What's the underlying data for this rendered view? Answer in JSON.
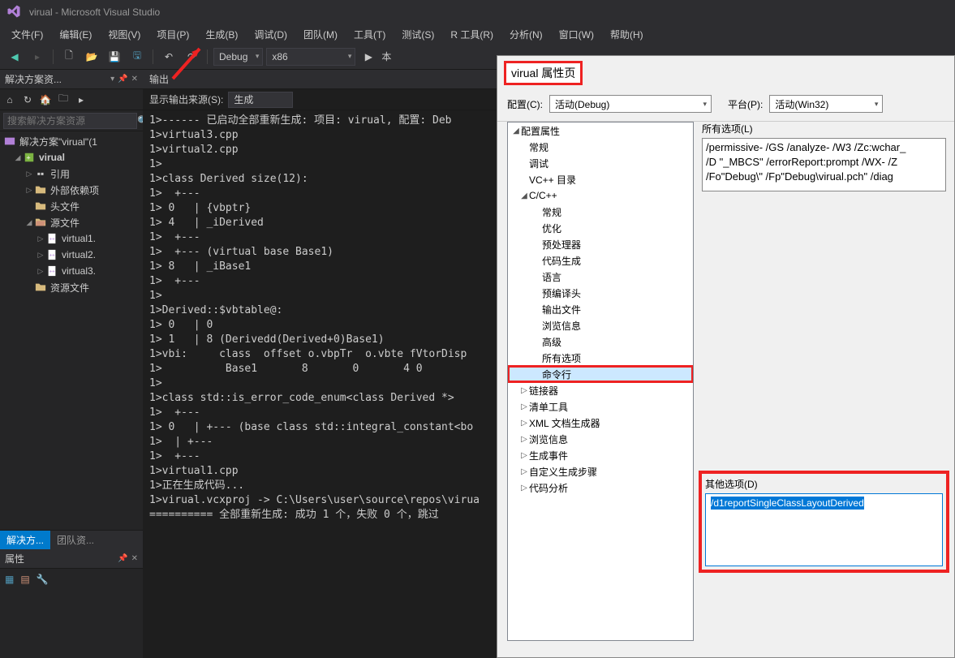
{
  "title": "virual - Microsoft Visual Studio",
  "menu": [
    "文件(F)",
    "编辑(E)",
    "视图(V)",
    "项目(P)",
    "生成(B)",
    "调试(D)",
    "团队(M)",
    "工具(T)",
    "测试(S)",
    "R 工具(R)",
    "分析(N)",
    "窗口(W)",
    "帮助(H)"
  ],
  "toolbar": {
    "config": "Debug",
    "platform": "x86",
    "run_prefix": "本"
  },
  "solution_explorer": {
    "title": "解决方案资...",
    "search_placeholder": "搜索解决方案资源",
    "tabs": [
      "解决方...",
      "团队资..."
    ],
    "root": "解决方案\"virual\"(1",
    "project": "virual",
    "refs": "引用",
    "external": "外部依赖项",
    "headers": "头文件",
    "sources": "源文件",
    "src_items": [
      "virtual1.",
      "virtual2.",
      "virtual3."
    ],
    "resources": "资源文件"
  },
  "properties_panel": {
    "title": "属性"
  },
  "output": {
    "title": "输出",
    "src_label": "显示输出来源(S):",
    "src_value": "生成",
    "lines": "1>------ 已启动全部重新生成: 项目: virual, 配置: Deb\n1>virtual3.cpp\n1>virtual2.cpp\n1>\n1>class Derived size(12):\n1>  +---\n1> 0   | {vbptr}\n1> 4   | _iDerived\n1>  +---\n1>  +--- (virtual base Base1)\n1> 8   | _iBase1\n1>  +---\n1>\n1>Derived::$vbtable@:\n1> 0   | 0\n1> 1   | 8 (Derivedd(Derived+0)Base1)\n1>vbi:     class  offset o.vbpTr  o.vbte fVtorDisp\n1>          Base1       8       0       4 0\n1>\n1>class std::is_error_code_enum<class Derived *>\n1>  +---\n1> 0   | +--- (base class std::integral_constant<bo\n1>  | +---\n1>  +---\n1>virtual1.cpp\n1>正在生成代码...\n1>virual.vcxproj -> C:\\Users\\user\\source\\repos\\virua\n========== 全部重新生成: 成功 1 个，失败 0 个，跳过"
  },
  "dialog": {
    "title": "virual 属性页",
    "config_label": "配置(C):",
    "config_value": "活动(Debug)",
    "platform_label": "平台(P):",
    "platform_value": "活动(Win32)",
    "tree": {
      "root": "配置属性",
      "general": "常规",
      "debug": "调试",
      "vcpp": "VC++ 目录",
      "ccpp": "C/C++",
      "ccpp_items": [
        "常规",
        "优化",
        "预处理器",
        "代码生成",
        "语言",
        "预编译头",
        "输出文件",
        "浏览信息",
        "高级",
        "所有选项",
        "命令行"
      ],
      "others": [
        "链接器",
        "清单工具",
        "XML 文档生成器",
        "浏览信息",
        "生成事件",
        "自定义生成步骤",
        "代码分析"
      ]
    },
    "all_opts_label": "所有选项(L)",
    "all_opts_text": "/permissive- /GS /analyze- /W3 /Zc:wchar_\n/D \"_MBCS\" /errorReport:prompt /WX- /Z\n/Fo\"Debug\\\" /Fp\"Debug\\virual.pch\" /diag",
    "other_opts_label": "其他选项(D)",
    "other_opts_value": "/d1reportSingleClassLayoutDerived"
  }
}
